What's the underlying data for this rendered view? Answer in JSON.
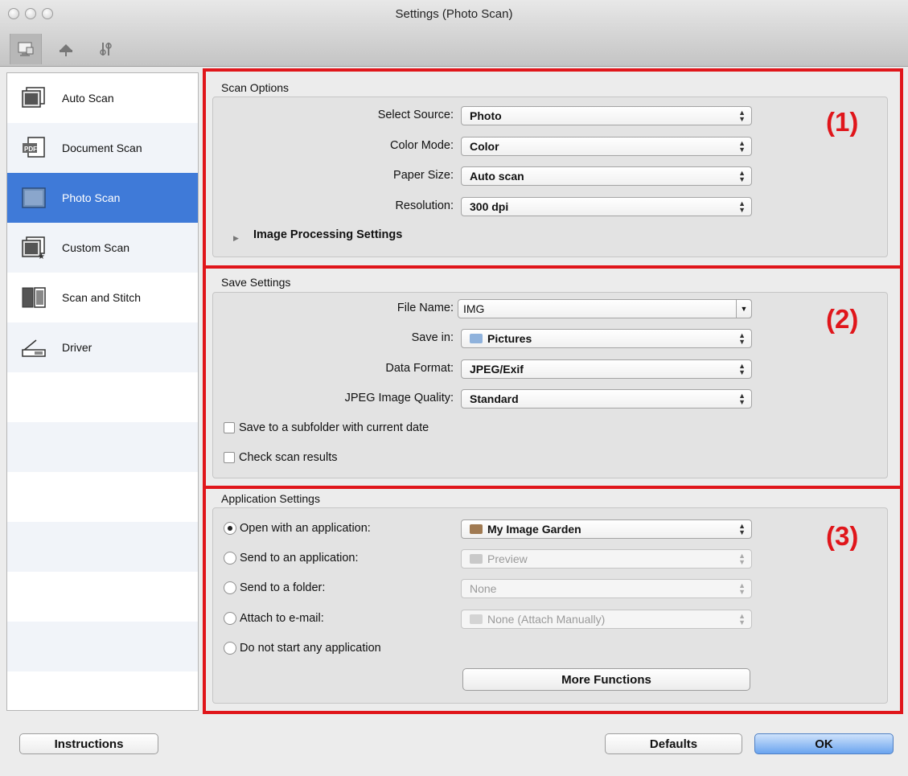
{
  "window": {
    "title": "Settings (Photo Scan)"
  },
  "toolbar": {
    "icons": [
      "scan-from-computer-icon",
      "scan-from-operation-panel-icon",
      "general-settings-icon"
    ]
  },
  "sidebar": {
    "items": [
      {
        "label": "Auto Scan",
        "icon": "auto-scan-icon",
        "selected": false
      },
      {
        "label": "Document Scan",
        "icon": "document-scan-icon",
        "selected": false
      },
      {
        "label": "Photo Scan",
        "icon": "photo-scan-icon",
        "selected": true
      },
      {
        "label": "Custom Scan",
        "icon": "custom-scan-icon",
        "selected": false
      },
      {
        "label": "Scan and Stitch",
        "icon": "scan-and-stitch-icon",
        "selected": false
      },
      {
        "label": "Driver",
        "icon": "driver-icon",
        "selected": false
      }
    ]
  },
  "scan_options": {
    "header": "Scan Options",
    "number": "(1)",
    "select_source": {
      "label": "Select Source:",
      "value": "Photo"
    },
    "color_mode": {
      "label": "Color Mode:",
      "value": "Color"
    },
    "paper_size": {
      "label": "Paper Size:",
      "value": "Auto scan"
    },
    "resolution": {
      "label": "Resolution:",
      "value": "300 dpi"
    },
    "image_processing": "Image Processing Settings"
  },
  "save_settings": {
    "header": "Save Settings",
    "number": "(2)",
    "file_name": {
      "label": "File Name:",
      "value": "IMG"
    },
    "save_in": {
      "label": "Save in:",
      "value": "Pictures"
    },
    "data_format": {
      "label": "Data Format:",
      "value": "JPEG/Exif"
    },
    "jpeg_quality": {
      "label": "JPEG Image Quality:",
      "value": "Standard"
    },
    "subfolder_checkbox": "Save to a subfolder with current date",
    "check_results_checkbox": "Check scan results"
  },
  "application_settings": {
    "header": "Application Settings",
    "number": "(3)",
    "open_with": {
      "label": "Open with an application:",
      "value": "My Image Garden"
    },
    "send_to_app": {
      "label": "Send to an application:",
      "value": "Preview"
    },
    "send_to_folder": {
      "label": "Send to a folder:",
      "value": "None"
    },
    "attach_email": {
      "label": "Attach to e-mail:",
      "value": "None (Attach Manually)"
    },
    "do_not_start": "Do not start any application",
    "more_functions": "More Functions"
  },
  "footer": {
    "instructions": "Instructions",
    "defaults": "Defaults",
    "ok": "OK"
  },
  "colors": {
    "highlight_red": "#e0161b",
    "selection_blue": "#3f7ad8"
  }
}
